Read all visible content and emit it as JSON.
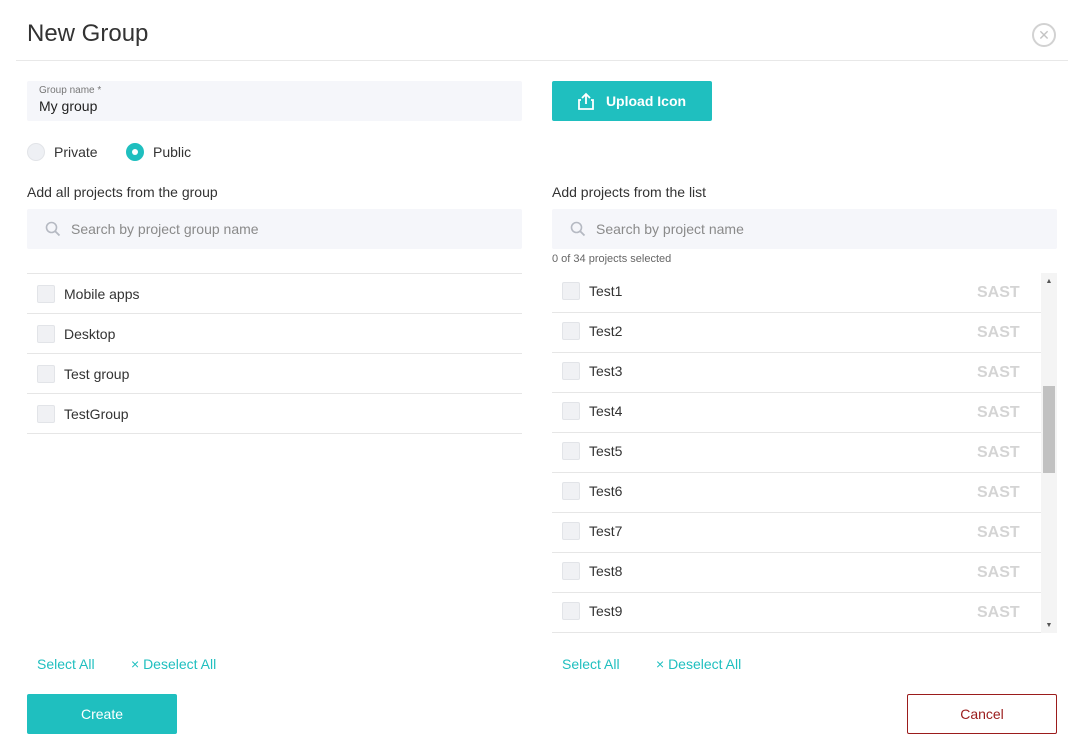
{
  "dialog": {
    "title": "New Group",
    "close_icon": "close-circle-icon"
  },
  "group_name": {
    "label": "Group name *",
    "value": "My group"
  },
  "upload": {
    "label": "Upload Icon",
    "icon": "upload-icon"
  },
  "visibility": {
    "options": [
      {
        "label": "Private",
        "selected": false
      },
      {
        "label": "Public",
        "selected": true
      }
    ]
  },
  "left_panel": {
    "heading": "Add all projects from the group",
    "search_placeholder": "Search by project group name",
    "items": [
      {
        "label": "Mobile apps",
        "checked": false
      },
      {
        "label": "Desktop",
        "checked": false
      },
      {
        "label": "Test group",
        "checked": false
      },
      {
        "label": "TestGroup",
        "checked": false
      }
    ],
    "select_all": "Select All",
    "deselect_all": "× Deselect All"
  },
  "right_panel": {
    "heading": "Add projects from the list",
    "search_placeholder": "Search by project name",
    "selection_count": "0 of 34 projects selected",
    "items": [
      {
        "label": "Test1",
        "tag": "SAST",
        "checked": false
      },
      {
        "label": "Test2",
        "tag": "SAST",
        "checked": false
      },
      {
        "label": "Test3",
        "tag": "SAST",
        "checked": false
      },
      {
        "label": "Test4",
        "tag": "SAST",
        "checked": false
      },
      {
        "label": "Test5",
        "tag": "SAST",
        "checked": false
      },
      {
        "label": "Test6",
        "tag": "SAST",
        "checked": false
      },
      {
        "label": "Test7",
        "tag": "SAST",
        "checked": false
      },
      {
        "label": "Test8",
        "tag": "SAST",
        "checked": false
      },
      {
        "label": "Test9",
        "tag": "SAST",
        "checked": false
      }
    ],
    "select_all": "Select All",
    "deselect_all": "× Deselect All"
  },
  "footer": {
    "create_label": "Create",
    "cancel_label": "Cancel"
  },
  "colors": {
    "accent": "#1fbfbf",
    "cancel": "#9b1c1c",
    "field_bg": "#f5f6fa"
  }
}
